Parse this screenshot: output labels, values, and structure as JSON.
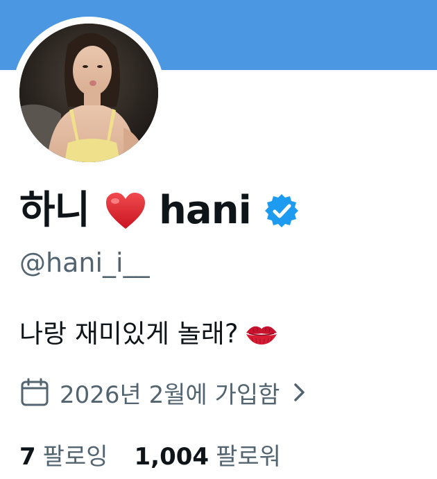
{
  "profile": {
    "display_name_prefix": "하니",
    "display_name_suffix": "hani",
    "handle": "@hani_i__",
    "bio": "나랑 재미있게 놀래?",
    "joined": "2026년 2월에 가입함",
    "following_count": "7",
    "following_label": "팔로잉",
    "followers_count": "1,004",
    "followers_label": "팔로워"
  },
  "icons": {
    "name_emoji": "red-heart-icon",
    "verified": "verified-badge-icon",
    "bio_emoji": "kiss-mark-icon",
    "joined": "calendar-icon",
    "joined_action": "chevron-right-icon"
  },
  "colors": {
    "banner": "#4b97e1",
    "verified": "#1d9bf0",
    "secondary_text": "#536471",
    "primary_text": "#0f1419",
    "heart": "#e0202f"
  }
}
